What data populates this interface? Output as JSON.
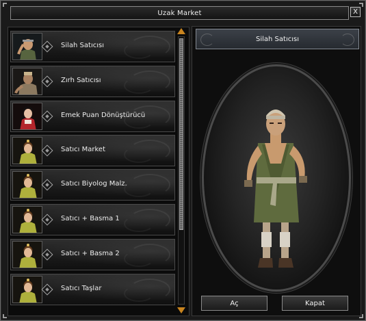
{
  "window": {
    "title": "Uzak Market",
    "close_glyph": "X"
  },
  "vendors": [
    {
      "label": "Silah Satıcısı",
      "portrait": "man-vendor-portrait"
    },
    {
      "label": "Zırh Satıcısı",
      "portrait": "armor-vendor-portrait"
    },
    {
      "label": "Emek Puan Dönüştürücü",
      "portrait": "red-dressed-woman-portrait"
    },
    {
      "label": "Satıcı Market",
      "portrait": "woman-vendor-portrait"
    },
    {
      "label": "Satıcı Biyolog Malz.",
      "portrait": "woman-vendor-portrait"
    },
    {
      "label": "Satıcı + Basma 1",
      "portrait": "woman-vendor-portrait"
    },
    {
      "label": "Satıcı + Basma 2",
      "portrait": "woman-vendor-portrait"
    },
    {
      "label": "Satıcı Taşlar",
      "portrait": "woman-vendor-portrait"
    }
  ],
  "preview": {
    "title": "Silah Satıcısı",
    "character": "weapon-vendor-full-body"
  },
  "buttons": {
    "open_label": "Aç",
    "close_label": "Kapat"
  },
  "colors": {
    "scroll_arrow": "#c8841f",
    "panel_bg": "#0b0b0b",
    "header_bg": "#31363d"
  }
}
